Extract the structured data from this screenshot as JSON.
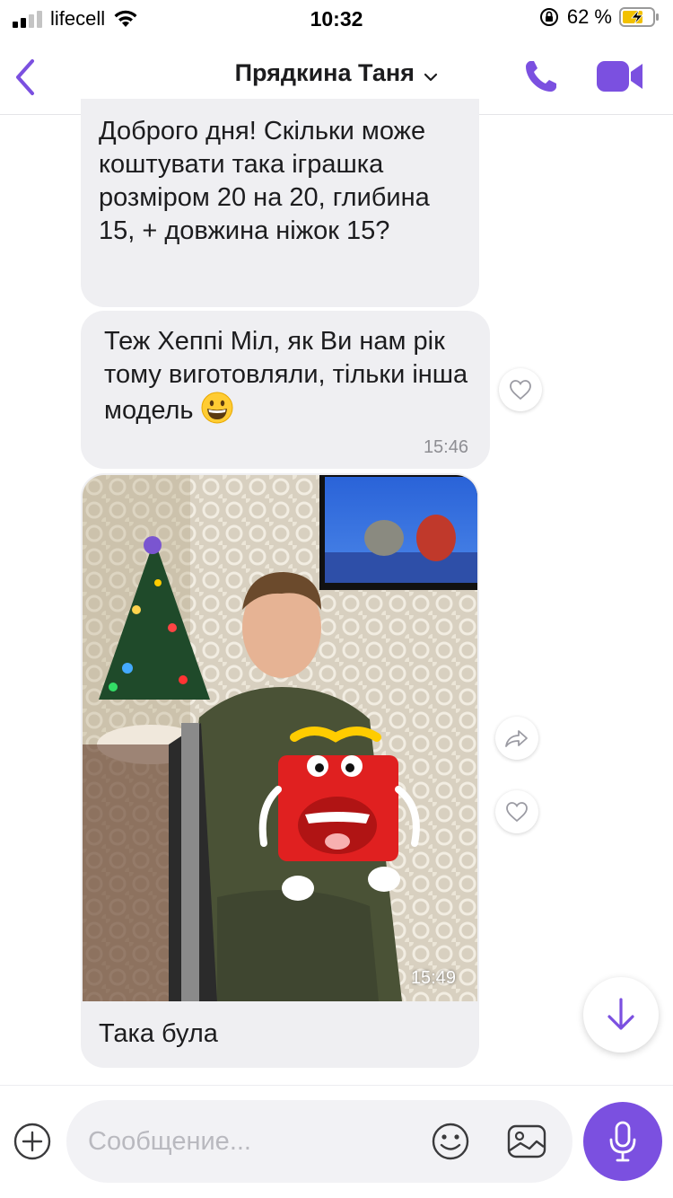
{
  "status_bar": {
    "carrier": "lifecell",
    "time": "10:32",
    "battery": "62 %"
  },
  "header": {
    "title": "Прядкина Таня",
    "icons": [
      "back-chevron",
      "chevron-down",
      "phone",
      "video-camera"
    ]
  },
  "messages": [
    {
      "text": "Доброго дня! Скільки може коштувати така іграшка розміром 20 на 20, глибина 15, + довжина ніжок 15?"
    },
    {
      "text": "Теж Хеппі Міл, як Ви нам рік тому виготовляли, тільки інша модель",
      "emoji": "grinning-face",
      "time": "15:46"
    },
    {
      "photo_time": "15:49",
      "caption": "Така була"
    }
  ],
  "composer": {
    "placeholder": "Сообщение..."
  },
  "colors": {
    "accent": "#7b50e0",
    "bubble": "#efeff2",
    "text": "#1c1c1e"
  }
}
